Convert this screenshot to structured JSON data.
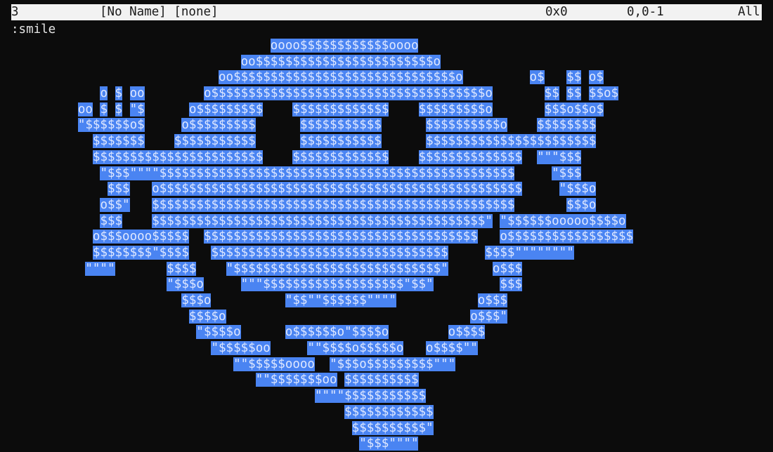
{
  "statusline": {
    "buffer_number": "3",
    "buffer_name": "[No Name] [none]",
    "char_info": "0x0",
    "position": "0,0-1",
    "scroll": "All"
  },
  "command_line": ":smile",
  "colors": {
    "background": "#0c0c0c",
    "statusline_bg": "#f2f2f2",
    "highlight_bg": "#4a84f2",
    "text": "#d8d8d8"
  },
  "art_lines": [
    "                                   oooo$$$$$$$$$$$$oooo",
    "                               oo$$$$$$$$$$$$$$$$$$$$$$$$o",
    "                            oo$$$$$$$$$$$$$$$$$$$$$$$$$$$$$$o         o$   $$ o$",
    "            o $ oo        o$$$$$$$$$$$$$$$$$$$$$$$$$$$$$$$$$$$$$o       $$ $$ $$o$",
    "         oo $ $ \"$      o$$$$$$$$$    $$$$$$$$$$$$$    $$$$$$$$$o       $$$o$$o$",
    "         \"$$$$$$o$     o$$$$$$$$$      $$$$$$$$$$$      $$$$$$$$$$o    $$$$$$$$",
    "           $$$$$$$    $$$$$$$$$$$      $$$$$$$$$$$      $$$$$$$$$$$$$$$$$$$$$$$",
    "           $$$$$$$$$$$$$$$$$$$$$$$    $$$$$$$$$$$$$    $$$$$$$$$$$$$$  \"\"\"$$$",
    "            \"$$$\"\"\"\"$$$$$$$$$$$$$$$$$$$$$$$$$$$$$$$$$$$$$$$$$$$$$$$$     \"$$$",
    "             $$$   o$$$$$$$$$$$$$$$$$$$$$$$$$$$$$$$$$$$$$$$$$$$$$$$$$     \"$$$o",
    "            o$$\"   $$$$$$$$$$$$$$$$$$$$$$$$$$$$$$$$$$$$$$$$$$$$$$$$$       $$$o",
    "            $$$    $$$$$$$$$$$$$$$$$$$$$$$$$$$$$$$$$$$$$$$$$$$$$\" \"$$$$$$ooooo$$$$o",
    "           o$$$oooo$$$$$  $$$$$$$$$$$$$$$$$$$$$$$$$$$$$$$$$$$$$   o$$$$$$$$$$$$$$$$$",
    "           $$$$$$$$\"$$$$   $$$$$$$$$$$$$$$$$$$$$$$$$$$$$$$$     $$$$\"\"\"\"\"\"\"\"",
    "          \"\"\"\"       $$$$    \"$$$$$$$$$$$$$$$$$$$$$$$$$$$$\"      o$$$",
    "                     \"$$$o     \"\"\"$$$$$$$$$$$$$$$$$$$\"$$\"         $$$",
    "                       $$$o          \"$$\"\"$$$$$$\"\"\"\"           o$$$",
    "                        $$$$o                                 o$$$\"",
    "                         \"$$$$o      o$$$$$$o\"$$$$o        o$$$$",
    "                           \"$$$$$oo     \"\"$$$$o$$$$$o   o$$$$\"\"",
    "                              \"\"$$$$$oooo  \"$$$o$$$$$$$$$\"\"\"",
    "                                 \"\"$$$$$$$oo $$$$$$$$$$",
    "                                         \"\"\"\"$$$$$$$$$$$",
    "                                             $$$$$$$$$$$$",
    "                                              $$$$$$$$$$\"",
    "                                               \"$$$\"\"\"\""
  ]
}
